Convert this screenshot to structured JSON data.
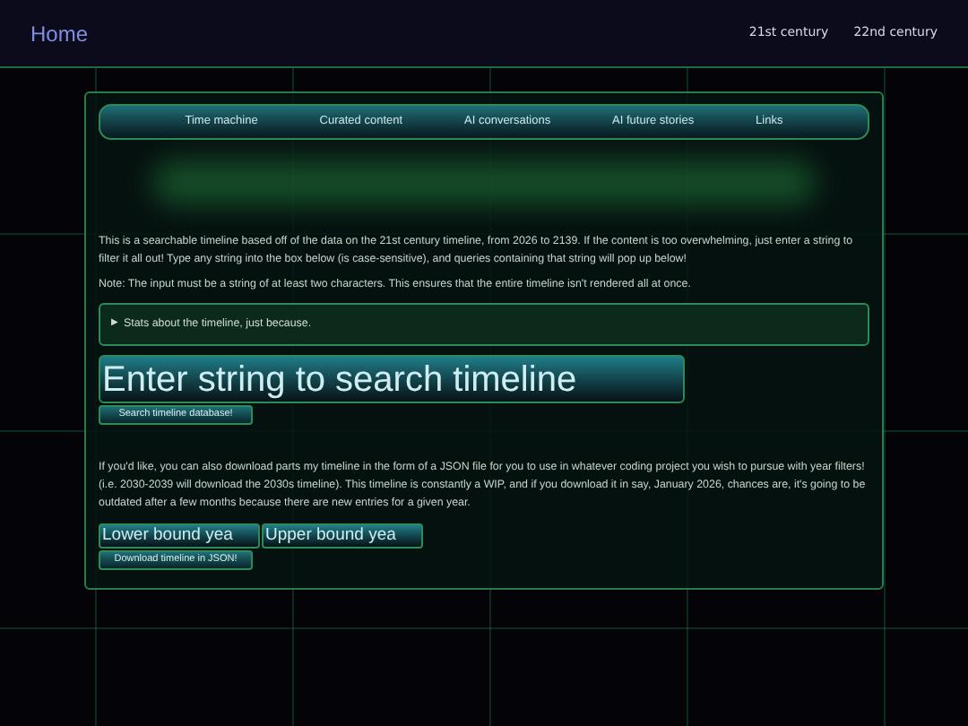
{
  "header": {
    "home": "Home",
    "links": [
      "21st century",
      "22nd century"
    ]
  },
  "nav": [
    "Time machine",
    "Curated content",
    "AI conversations",
    "AI future stories",
    "Links"
  ],
  "intro": "This is a searchable timeline based off of the data on the 21st century timeline, from 2026 to 2139. If the content is too overwhelming, just enter a string to filter it all out! Type any string into the box below (is case-sensitive), and queries containing that string will pop up below!",
  "note": "Note: The input must be a string of at least two characters. This ensures that the entire timeline isn't rendered all at once.",
  "stats": {
    "marker": "▶",
    "label": "Stats about the timeline, just because.",
    "expanded": false
  },
  "search": {
    "placeholder": "Enter string to search timeline",
    "button": "Search timeline database!"
  },
  "download_text": "If you'd like, you can also download parts my timeline in the form of a JSON file for you to use in whatever coding project you wish to pursue with year filters! (i.e. 2030-2039 will download the 2030s timeline). This timeline is constantly a WIP, and if you download it in say, January 2026, chances are, it's going to be outdated after a few months because there are new entries for a given year.",
  "range": {
    "lower_placeholder": "Lower bound yea",
    "upper_placeholder": "Upper bound yea",
    "button": "Download timeline in JSON!"
  }
}
